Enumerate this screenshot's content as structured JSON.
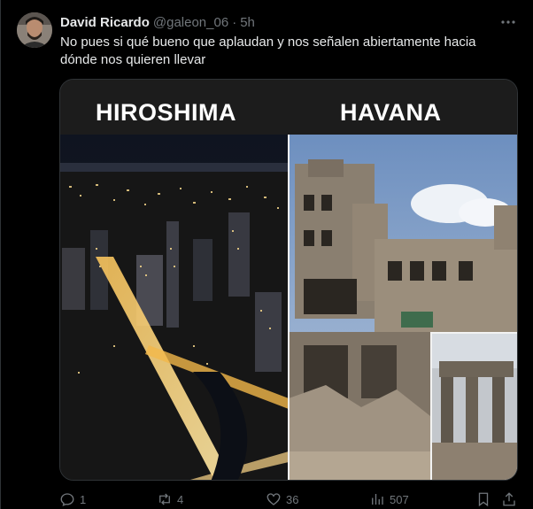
{
  "tweet": {
    "author_name": "David Ricardo",
    "handle": "@galeon_06",
    "separator": "·",
    "time": "5h",
    "text": "No pues si qué bueno que aplaudan y nos señalen abiertamente hacia dónde nos quieren llevar"
  },
  "media": {
    "left_label": "HIROSHIMA",
    "right_label": "HAVANA"
  },
  "actions": {
    "replies": "1",
    "retweets": "4",
    "likes": "36",
    "views": "507"
  },
  "icons": {
    "more": "more-dots-icon",
    "reply": "reply-icon",
    "retweet": "retweet-icon",
    "like": "heart-icon",
    "views": "views-icon",
    "bookmark": "bookmark-icon",
    "share": "share-icon"
  },
  "colors": {
    "background": "#000000",
    "text": "#e7e9ea",
    "muted": "#71767b",
    "border": "#2f3336"
  }
}
